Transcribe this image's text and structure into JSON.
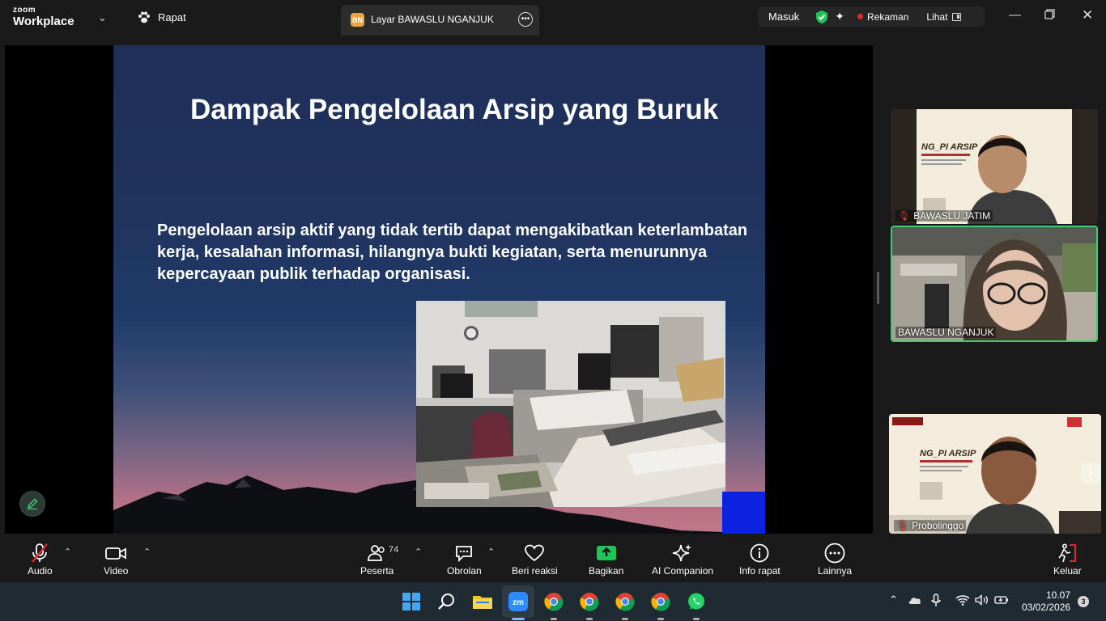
{
  "titlebar": {
    "brand_top": "zoom",
    "brand_bottom": "Workplace",
    "meeting_label": "Rapat",
    "share_tab": {
      "badge": "BN",
      "label": "Layar BAWASLU NGANJUK"
    },
    "status": {
      "signin": "Masuk",
      "recording": "Rekaman",
      "view": "Lihat"
    }
  },
  "slide": {
    "title": "Dampak Pengelolaan Arsip yang Buruk",
    "body": "Pengelolaan arsip aktif yang tidak tertib dapat mengakibatkan keterlambatan kerja, kesalahan informasi, hilangnya bukti kegiatan, serta menurunnya kepercayaan publik terhadap organisasi."
  },
  "participants": [
    {
      "name": "BAWASLU JATIM",
      "muted": true
    },
    {
      "name": "BAWASLU NGANJUK",
      "muted": false,
      "active_speaker": true
    },
    {
      "name": "Probolinggo",
      "muted": true
    }
  ],
  "toolbar": {
    "audio": "Audio",
    "video": "Video",
    "participants": "Peserta",
    "participants_count": "74",
    "chat": "Obrolan",
    "react": "Beri reaksi",
    "share": "Bagikan",
    "ai": "AI Companion",
    "info": "Info rapat",
    "more": "Lainnya",
    "leave": "Keluar"
  },
  "taskbar": {
    "time": "10.07",
    "date": "03/02/2026",
    "notifications": "3"
  },
  "colors": {
    "accent_green": "#1fc45a",
    "record_red": "#e0282e",
    "active_border": "#3ecf72"
  }
}
